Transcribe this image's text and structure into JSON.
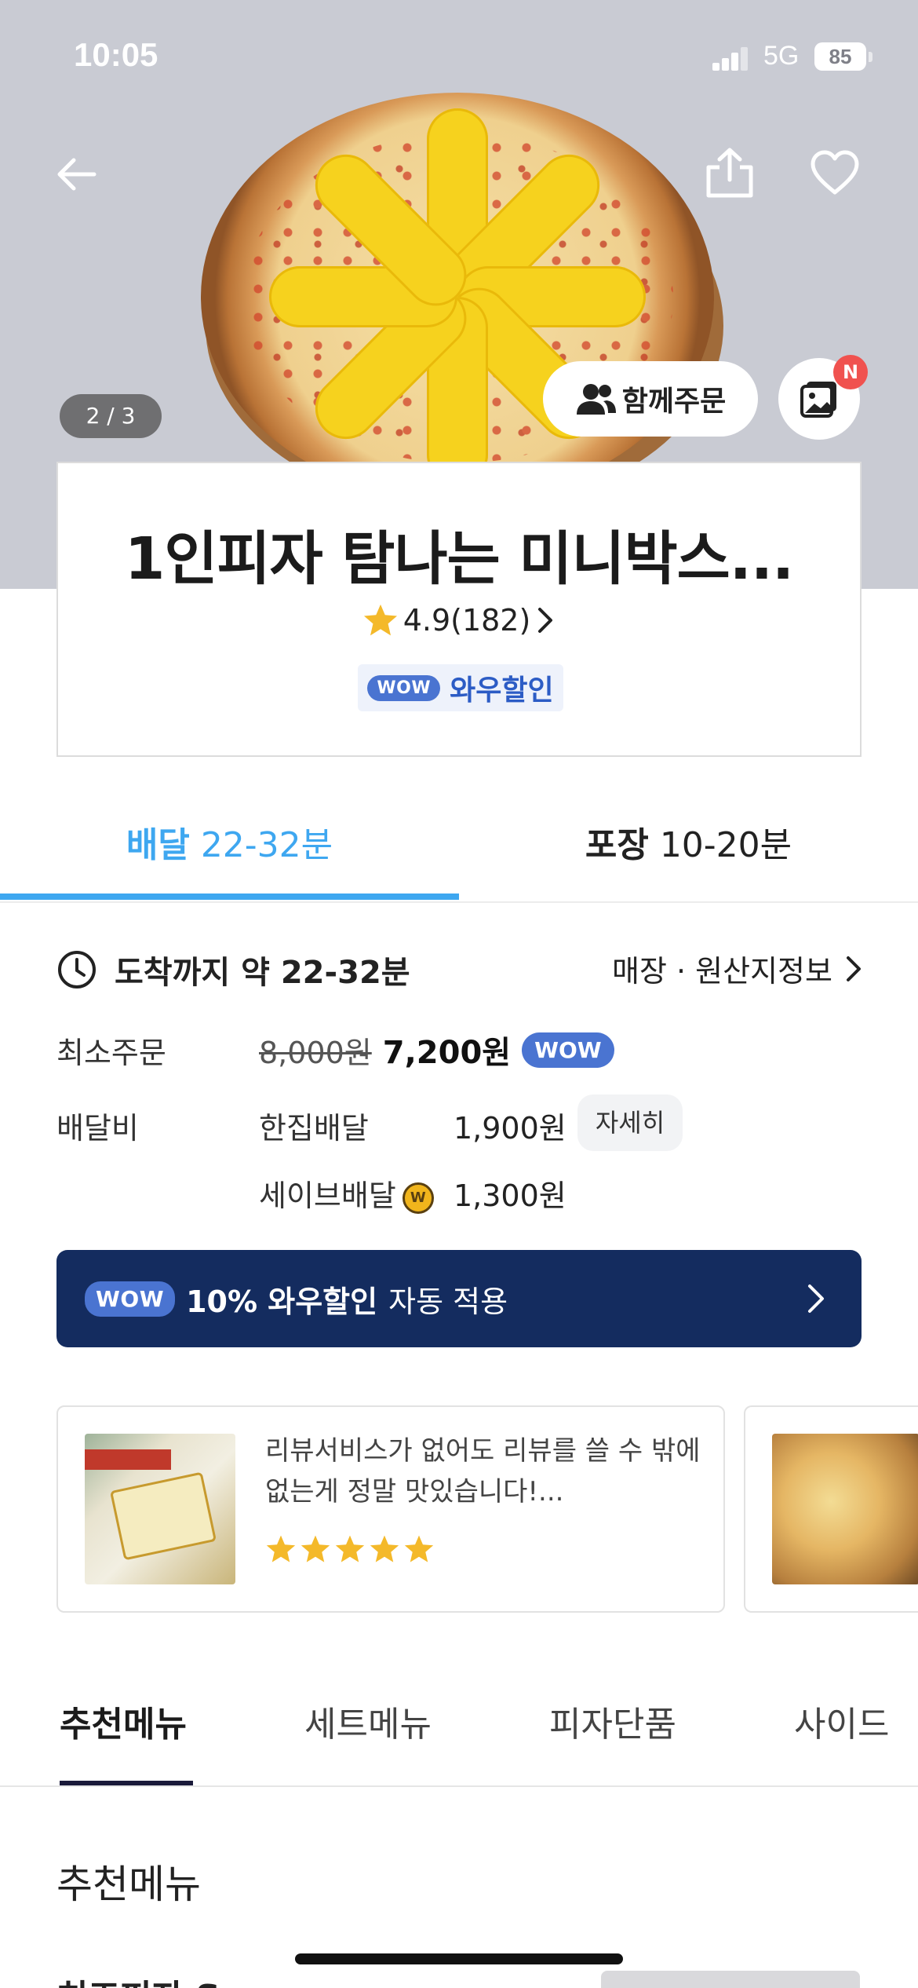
{
  "status_bar": {
    "time": "10:05",
    "network": "5G",
    "battery": "85"
  },
  "hero": {
    "image_counter": "2 / 3",
    "together_order_label": "함께주문",
    "photo_badge": "N"
  },
  "store": {
    "name": "1인피자 탐나는 미니박스...",
    "rating": "4.9(182)",
    "wow_pill": "WOW",
    "wow_discount_label": "와우할인"
  },
  "order_tabs": [
    {
      "type": "배달",
      "time": "22-32분",
      "active": true
    },
    {
      "type": "포장",
      "time": "10-20분",
      "active": false
    }
  ],
  "delivery": {
    "arrival_label": "도착까지 약 22-32분",
    "store_info_link": "매장 · 원산지정보",
    "min_order_label": "최소주문",
    "min_order_original": "8,000원",
    "min_order_price": "7,200원",
    "min_order_wow": "WOW",
    "fee_label": "배달비",
    "fees": [
      {
        "name": "한집배달",
        "price": "1,900원"
      },
      {
        "name": "세이브배달",
        "price": "1,300원"
      }
    ],
    "detail_button": "자세히"
  },
  "wow_banner": {
    "pill": "WOW",
    "highlight": "10% 와우할인",
    "rest": "자동 적용"
  },
  "reviews": [
    {
      "text": "리뷰서비스가 없어도 리뷰를 쓸 수 밖에 없는게 정말 맛있습니다!...",
      "stars": 5
    }
  ],
  "menu_tabs": [
    {
      "label": "추천메뉴",
      "active": true
    },
    {
      "label": "세트메뉴",
      "active": false
    },
    {
      "label": "피자단품",
      "active": false
    },
    {
      "label": "사이드",
      "active": false
    }
  ],
  "section_title": "추천메뉴",
  "partial_item_name": "치즈피자 S",
  "colors": {
    "accent_blue": "#3ea7f0",
    "wow_blue": "#4a74d1",
    "banner_navy": "#142c5f",
    "star": "#f4b92a",
    "badge_red": "#f0524f"
  },
  "icons": [
    "back-arrow-icon",
    "share-icon",
    "heart-icon",
    "people-icon",
    "photo-album-icon",
    "star-icon",
    "chevron-right-icon",
    "clock-icon",
    "save-coin-icon"
  ]
}
